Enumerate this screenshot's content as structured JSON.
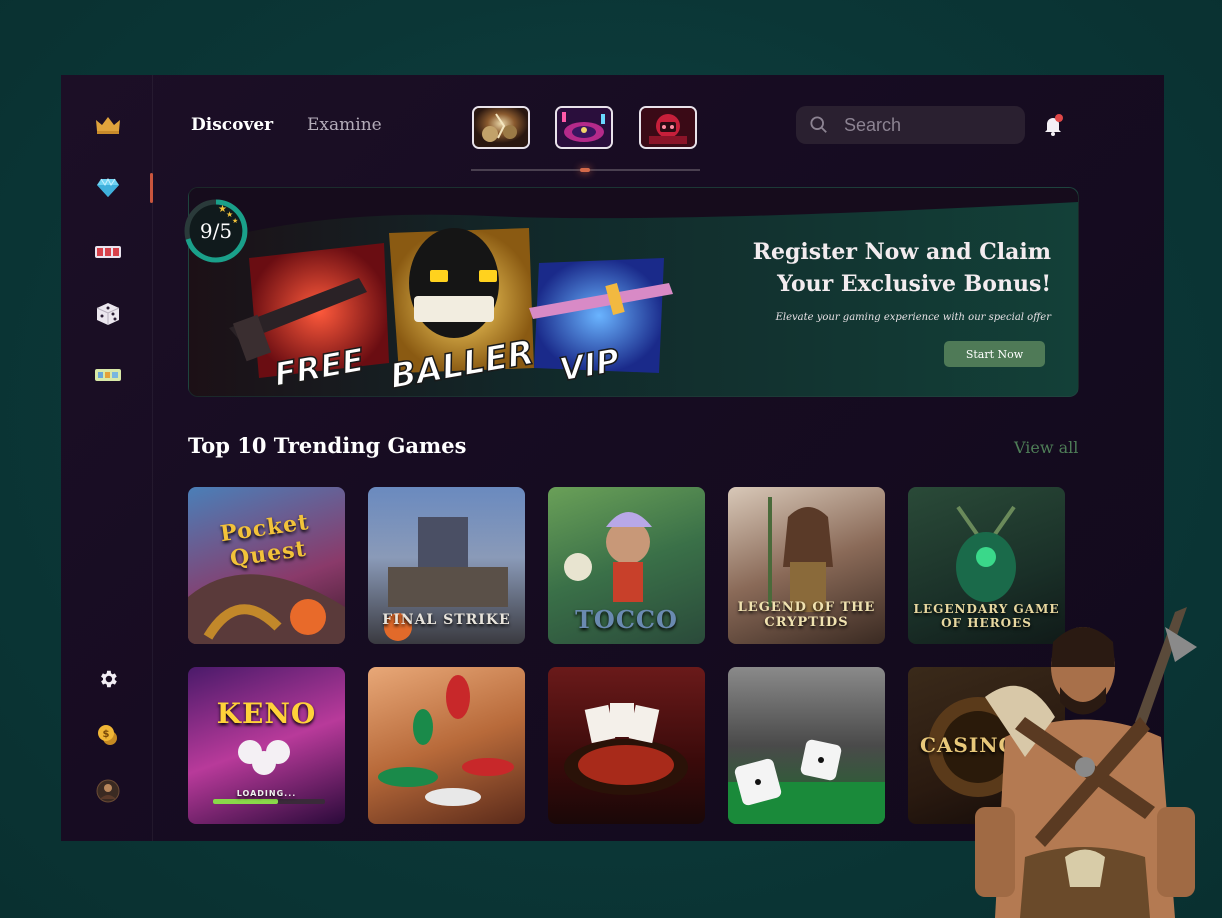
{
  "nav": {
    "tabs": [
      {
        "label": "Discover"
      },
      {
        "label": "Examine"
      }
    ]
  },
  "search": {
    "placeholder": "Search"
  },
  "sidebar": {
    "items": [
      "crown-icon",
      "diamond-icon",
      "slots-icon",
      "dice-icon",
      "ticket-icon",
      "gear-icon",
      "coins-icon",
      "avatar"
    ]
  },
  "banner": {
    "rating": "9/5",
    "title": "Register Now and Claim Your Exclusive Bonus!",
    "subtitle": "Elevate your gaming experience with our special offer",
    "cta": "Start Now",
    "cases": [
      "FREE",
      "BALLER",
      "VIP"
    ]
  },
  "trending": {
    "title": "Top 10 Trending Games",
    "view_all": "View all",
    "games": [
      {
        "label": "Pocket Quest"
      },
      {
        "label": "FINAL STRIKE"
      },
      {
        "label": "TOCCO"
      },
      {
        "label": "LEGEND OF THE CRYPTIDS"
      },
      {
        "label": "LEGENDARY GAME OF HEROES"
      },
      {
        "label": "KENO",
        "sub": "LOADING..."
      },
      {
        "label": ""
      },
      {
        "label": ""
      },
      {
        "label": ""
      },
      {
        "label": "CASINO"
      }
    ]
  },
  "colors": {
    "accent": "#4f7a57",
    "active": "#c9553d",
    "bg": "#0c3a3a"
  }
}
